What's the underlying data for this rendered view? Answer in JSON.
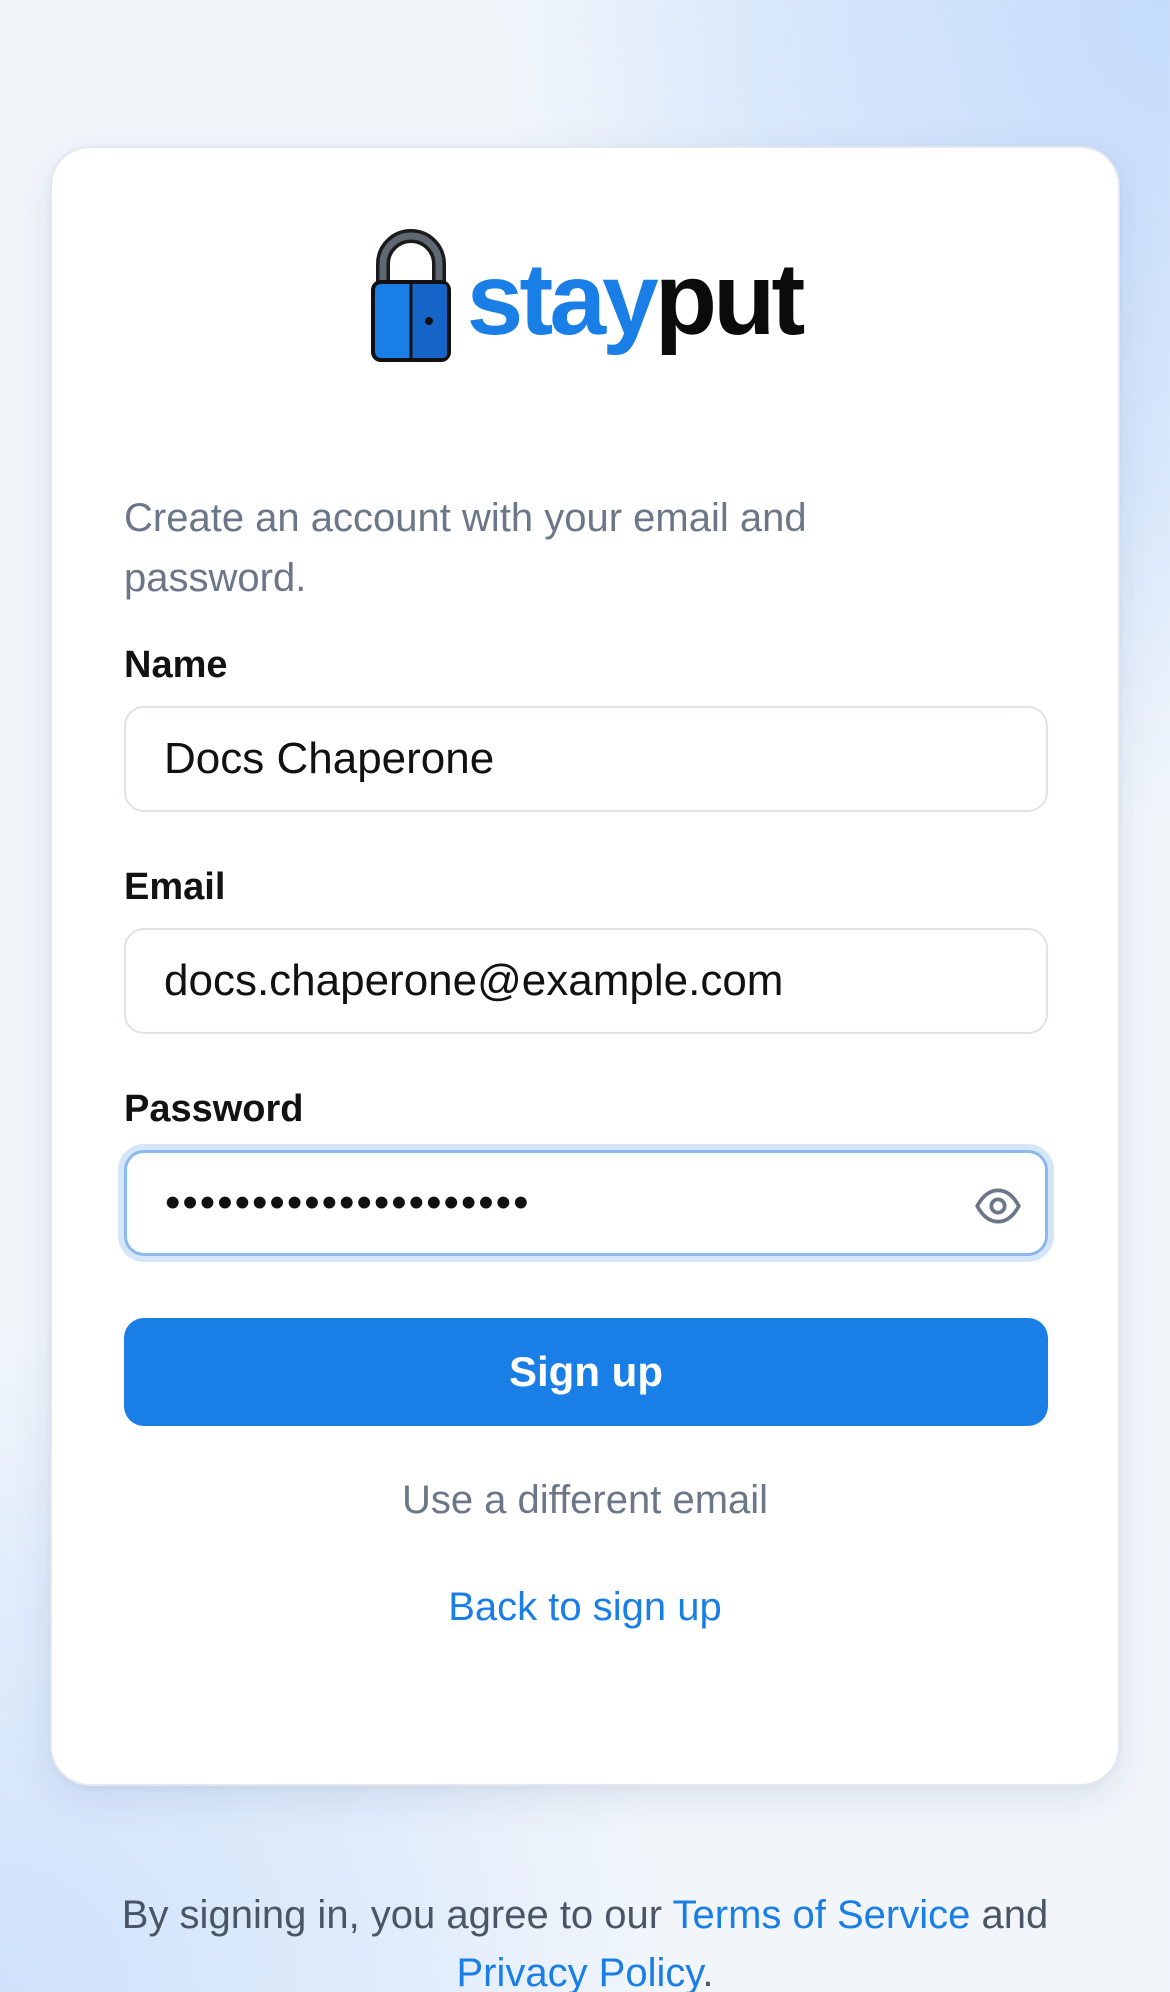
{
  "brand": {
    "name_part1": "stay",
    "name_part2": "put",
    "logo_icon": "padlock-icon",
    "colors": {
      "accent": "#1a7ee7",
      "dark": "#0b0b0b"
    }
  },
  "form": {
    "intro": "Create an account with your email and password.",
    "name": {
      "label": "Name",
      "value": "Docs Chaperone"
    },
    "email": {
      "label": "Email",
      "value": "docs.chaperone@example.com"
    },
    "password": {
      "label": "Password",
      "masked_value": "•••••••••••••••••••••",
      "toggle_icon": "eye-icon"
    },
    "submit_label": "Sign up",
    "alt_email_link": "Use a different email",
    "back_link": "Back to sign up"
  },
  "footer": {
    "prefix": "By signing in, you agree to our ",
    "terms": "Terms of Service",
    "middle": " and ",
    "privacy": "Privacy Policy",
    "suffix": "."
  }
}
